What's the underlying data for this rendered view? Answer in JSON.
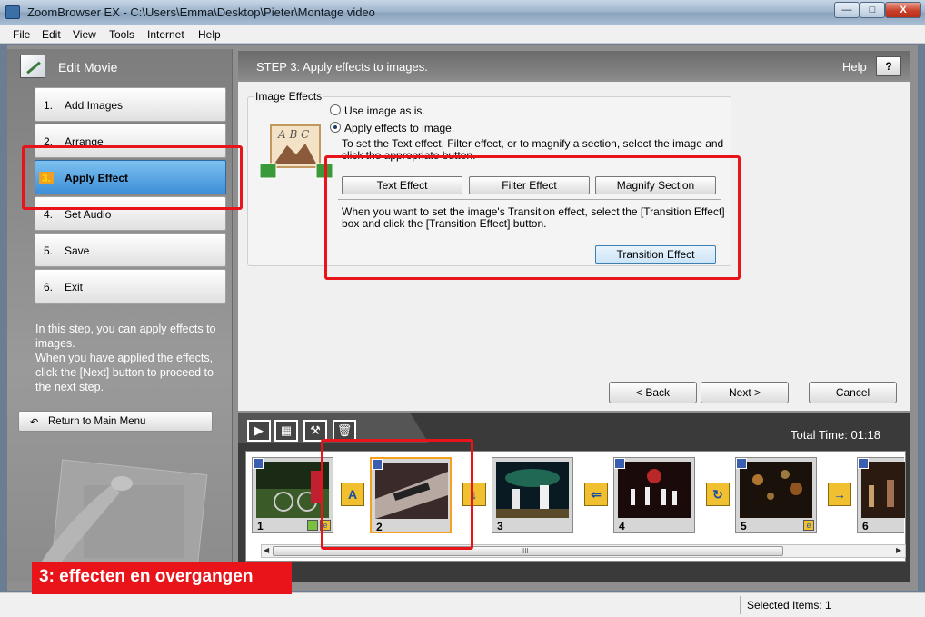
{
  "window": {
    "title": "ZoomBrowser EX - C:\\Users\\Emma\\Desktop\\Pieter\\Montage video",
    "min_symbol": "—",
    "max_symbol": "□",
    "close_symbol": "X"
  },
  "menu": [
    "File",
    "Edit",
    "View",
    "Tools",
    "Internet",
    "Help"
  ],
  "sidebar": {
    "title": "Edit Movie",
    "steps": [
      {
        "num": "1.",
        "label": "Add Images"
      },
      {
        "num": "2.",
        "label": "Arrange"
      },
      {
        "num": "3.",
        "label": "Apply Effect"
      },
      {
        "num": "4.",
        "label": "Set Audio"
      },
      {
        "num": "5.",
        "label": "Save"
      },
      {
        "num": "6.",
        "label": "Exit"
      }
    ],
    "description_1": "In this step, you can apply effects to images.",
    "description_2": "When you have applied the effects, click the [Next] button to proceed to the next step.",
    "main_menu_button": "Return to Main Menu",
    "main_menu_icon": "↶"
  },
  "main": {
    "step_title": "STEP 3: Apply effects to images.",
    "help_label": "Help",
    "help_button": "?",
    "group_label": "Image Effects",
    "option_as_is": "Use image as is.",
    "option_apply": "Apply effects to image.",
    "instruction_1": "To set the Text effect, Filter effect, or to magnify a section, select the image and click the appropriate button.",
    "text_effect": "Text Effect",
    "filter_effect": "Filter Effect",
    "magnify_section": "Magnify Section",
    "instruction_2": "When you want to set the image's Transition effect, select the [Transition Effect] box and click the [Transition Effect] button.",
    "transition_effect": "Transition Effect",
    "back": "< Back",
    "next": "Next >",
    "cancel": "Cancel"
  },
  "timeline": {
    "controls": [
      "▶",
      "▦",
      "⚒",
      "🗑"
    ],
    "total_time": "Total Time: 01:18",
    "frames": [
      "1",
      "2",
      "3",
      "4",
      "5",
      "6"
    ],
    "transitions": [
      "A",
      "↓",
      "⇐",
      "↻",
      "→"
    ],
    "badge_e": "e",
    "scroll_grip": "III",
    "scroll_left": "◀",
    "scroll_right": "▶"
  },
  "status": {
    "selected": "Selected Items: 1"
  },
  "annotation": {
    "label": "3: effecten en overgangen",
    "color": "#e8141a"
  }
}
